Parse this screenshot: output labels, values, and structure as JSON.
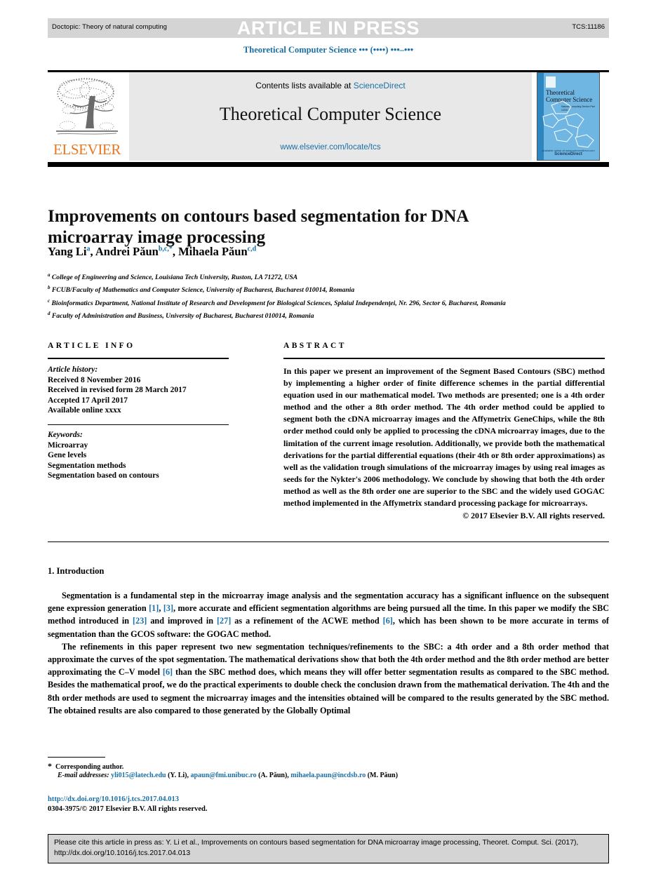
{
  "topbar": {
    "doctopic": "Doctopic: Theory of natural computing",
    "article_in_press": "ARTICLE IN PRESS",
    "tcs_id": "TCS:11186"
  },
  "running_head": "Theoretical Computer Science ••• (••••) •••–•••",
  "masthead": {
    "publisher": "ELSEVIER",
    "contents_prefix": "Contents lists available at ",
    "contents_link": "ScienceDirect",
    "journal_name": "Theoretical Computer Science",
    "journal_url": "www.elsevier.com/locate/tcs",
    "cover": {
      "title": "Theoretical Computer Science",
      "subtitle": "Natural Computing Section\nPart 1/2011",
      "footer_line1": "Available online at www.sciencedirect.com",
      "footer_line2": "ScienceDirect"
    }
  },
  "article": {
    "title": "Improvements on contours based segmentation for DNA microarray image processing",
    "authors": [
      {
        "name": "Yang Li",
        "sup": "a"
      },
      {
        "name": "Andrei Păun",
        "sup": "b,c,*"
      },
      {
        "name": "Mihaela Păun",
        "sup": "c,d"
      }
    ],
    "affiliations": [
      {
        "mark": "a",
        "text": "College of Engineering and Science, Louisiana Tech University, Ruston, LA 71272, USA"
      },
      {
        "mark": "b",
        "text": "FCUB/Faculty of Mathematics and Computer Science, University of Bucharest, Bucharest 010014, Romania"
      },
      {
        "mark": "c",
        "text": "Bioinformatics Department, National Institute of Research and Development for Biological Sciences, Splaiul Independenţei, Nr. 296, Sector 6, Bucharest, Romania"
      },
      {
        "mark": "d",
        "text": "Faculty of Administration and Business, University of Bucharest, Bucharest 010014, Romania"
      }
    ]
  },
  "info": {
    "heading": "ARTICLE INFO",
    "history_label": "Article history:",
    "history": [
      "Received 8 November 2016",
      "Received in revised form 28 March 2017",
      "Accepted 17 April 2017",
      "Available online xxxx"
    ],
    "keywords_label": "Keywords:",
    "keywords": [
      "Microarray",
      "Gene levels",
      "Segmentation methods",
      "Segmentation based on contours"
    ]
  },
  "abstract": {
    "heading": "ABSTRACT",
    "text": "In this paper we present an improvement of the Segment Based Contours (SBC) method by implementing a higher order of finite difference schemes in the partial differential equation used in our mathematical model. Two methods are presented; one is a 4th order method and the other a 8th order method. The 4th order method could be applied to segment both the cDNA microarray images and the Affymetrix GeneChips, while the 8th order method could only be applied to processing the cDNA microarray images, due to the limitation of the current image resolution. Additionally, we provide both the mathematical derivations for the partial differential equations (their 4th or 8th order approximations) as well as the validation trough simulations of the microarray images by using real images as seeds for the Nykter's 2006 methodology. We conclude by showing that both the 4th order method as well as the 8th order one are superior to the SBC and the widely used GOGAC method implemented in the Affymetrix standard processing package for microarrays.",
    "copyright": "© 2017 Elsevier B.V. All rights reserved."
  },
  "body": {
    "section_heading": "1. Introduction",
    "paragraph1_parts": [
      "Segmentation is a fundamental step in the microarray image analysis and the segmentation accuracy has a significant influence on the subsequent gene expression generation ",
      "[1]",
      ", ",
      "[3]",
      ", more accurate and efficient segmentation algorithms are being pursued all the time. In this paper we modify the SBC method introduced in ",
      "[23]",
      " and improved in ",
      "[27]",
      " as a refinement of the ACWE method ",
      "[6]",
      ", which has been shown to be more accurate in terms of segmentation than the GCOS software: the GOGAC method."
    ],
    "paragraph2_parts": [
      "The refinements in this paper represent two new segmentation techniques/refinements to the SBC: a 4th order and a 8th order method that approximate the curves of the spot segmentation. The mathematical derivations show that both the 4th order method and the 8th order method are better approximating the C–V model ",
      "[6]",
      " than the SBC method does, which means they will offer better segmentation results as compared to the SBC method. Besides the mathematical proof, we do the practical experiments to double check the conclusion drawn from the mathematical derivation. The 4th and the 8th order methods are used to segment the microarray images and the intensities obtained will be compared to the results generated by the SBC method. The obtained results are also compared to those generated by the Globally Optimal"
    ]
  },
  "footnotes": {
    "corresponding": "Corresponding author.",
    "email_label": "E-mail addresses:",
    "emails": [
      {
        "address": "yli015@latech.edu",
        "owner": "(Y. Li)"
      },
      {
        "address": "apaun@fmi.unibuc.ro",
        "owner": "(A. Păun)"
      },
      {
        "address": "mihaela.paun@incdsb.ro",
        "owner": "(M. Păun)"
      }
    ],
    "doi": "http://dx.doi.org/10.1016/j.tcs.2017.04.013",
    "issn_line": "0304-3975/© 2017 Elsevier B.V. All rights reserved."
  },
  "cite_box": {
    "text": "Please cite this article in press as: Y. Li et al., Improvements on contours based segmentation for DNA microarray image processing, Theoret. Comput. Sci. (2017), http://dx.doi.org/10.1016/j.tcs.2017.04.013"
  },
  "colors": {
    "link": "#1a6fa6",
    "elsevier_orange": "#E87722",
    "topbar_gray": "#d4d4d4",
    "masthead_gray": "#e8e8e8"
  }
}
